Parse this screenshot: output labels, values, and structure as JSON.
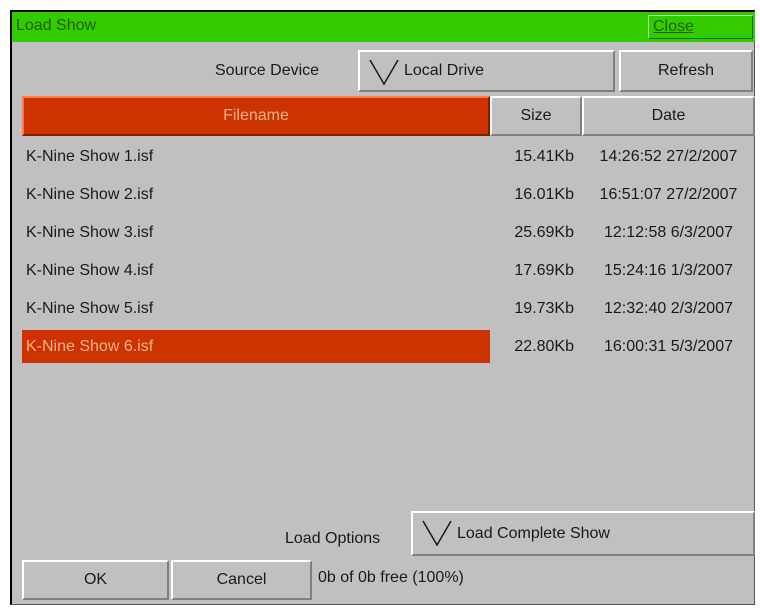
{
  "window": {
    "title": "Load Show",
    "close_label": "Close",
    "title_bar_color": "#33cc00",
    "highlight_color": "#cc3300"
  },
  "source": {
    "label": "Source Device",
    "selected": "Local Drive",
    "refresh_label": "Refresh"
  },
  "table": {
    "headers": {
      "filename": "Filename",
      "size": "Size",
      "date": "Date"
    },
    "sorted_by": "Filename",
    "selected_index": 5,
    "rows": [
      {
        "filename": "K-Nine Show 1.isf",
        "size": "15.41Kb",
        "date": "14:26:52 27/2/2007"
      },
      {
        "filename": "K-Nine Show 2.isf",
        "size": "16.01Kb",
        "date": "16:51:07 27/2/2007"
      },
      {
        "filename": "K-Nine Show 3.isf",
        "size": "25.69Kb",
        "date": "12:12:58 6/3/2007"
      },
      {
        "filename": "K-Nine Show 4.isf",
        "size": "17.69Kb",
        "date": "15:24:16 1/3/2007"
      },
      {
        "filename": "K-Nine Show 5.isf",
        "size": "19.73Kb",
        "date": "12:32:40 2/3/2007"
      },
      {
        "filename": "K-Nine Show 6.isf",
        "size": "22.80Kb",
        "date": "16:00:31 5/3/2007"
      }
    ]
  },
  "load_options": {
    "label": "Load Options",
    "selected": "Load Complete Show"
  },
  "footer": {
    "ok_label": "OK",
    "cancel_label": "Cancel",
    "status": "0b of 0b free (100%)"
  },
  "icons": {
    "dropdown": "chevron-down-icon"
  }
}
